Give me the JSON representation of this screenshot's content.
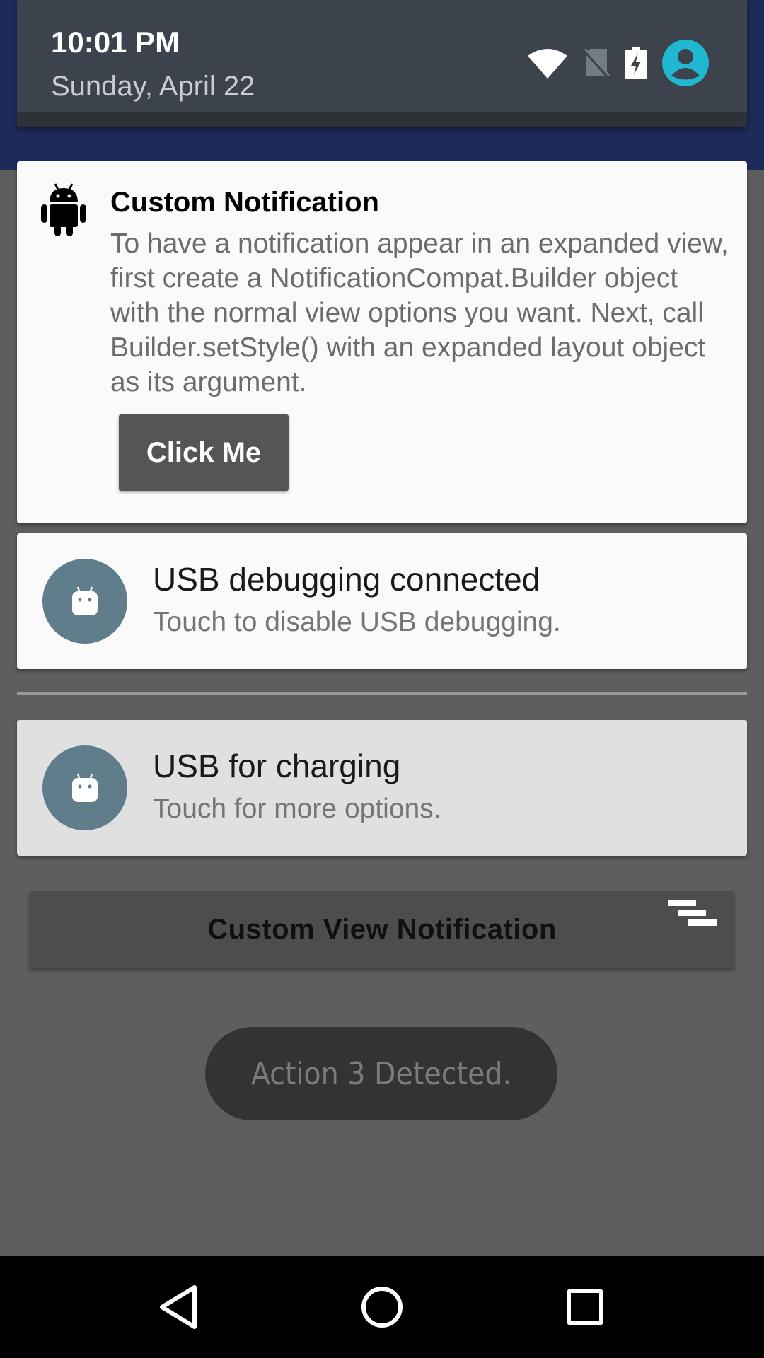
{
  "status": {
    "time": "10:01 PM",
    "date": "Sunday, April 22",
    "icons": [
      "wifi-icon",
      "no-sim-icon",
      "battery-charging-icon",
      "account-icon"
    ],
    "account_color": "#1fb8d0"
  },
  "notifications": {
    "custom": {
      "icon": "android-icon",
      "title": "Custom Notification",
      "text": "To have a notification appear in an expanded view, first create a NotificationCompat.Builder object with the normal view options you want. Next, call Builder.setStyle() with an expanded layout object as its argument.",
      "button_label": "Click Me"
    },
    "usb_debugging": {
      "icon": "android-head-icon",
      "title": "USB debugging connected",
      "subtitle": "Touch to disable USB debugging."
    },
    "usb_charging": {
      "icon": "android-head-icon",
      "title": "USB for charging",
      "subtitle": "Touch for more options."
    }
  },
  "app": {
    "button_label": "Custom View Notification",
    "toast": "Action 3 Detected."
  },
  "nav": {
    "icons": [
      "back-icon",
      "home-icon",
      "recents-icon"
    ]
  },
  "colors": {
    "notification_icon_bg": "#607d8b",
    "header_bg": "#3c434c",
    "app_bar": "#1e2a5a"
  }
}
